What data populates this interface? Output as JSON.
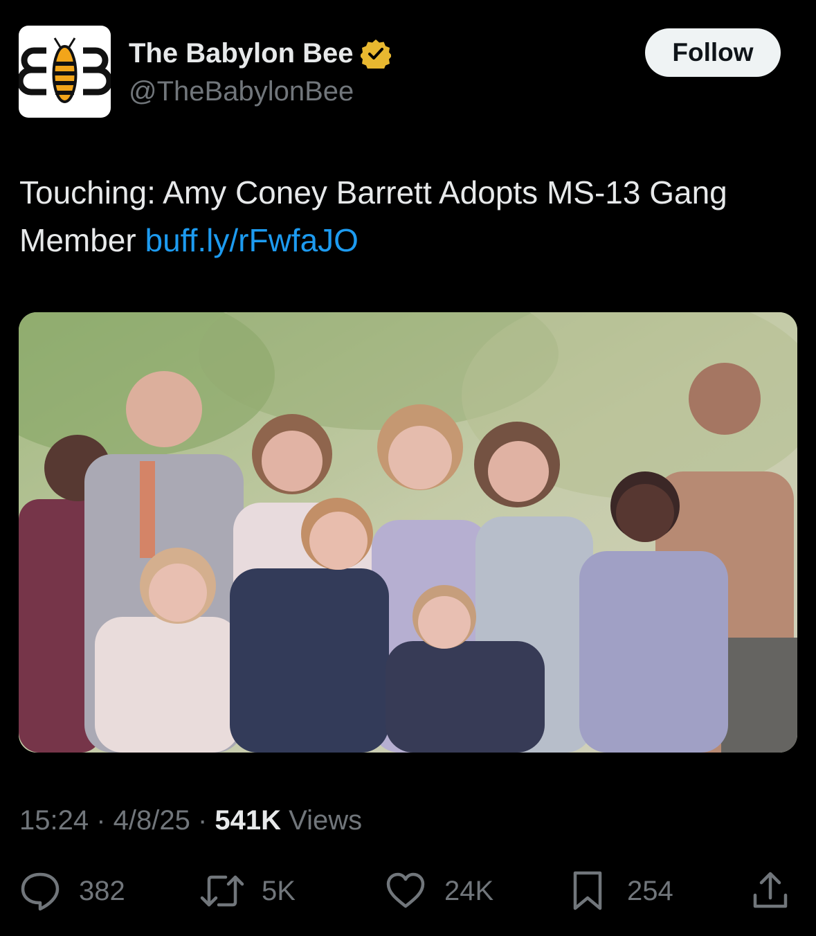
{
  "author": {
    "display_name": "The Babylon Bee",
    "handle": "@TheBabylonBee",
    "verified_badge_color": "#e8b830",
    "avatar_icon": "babylon-bee-logo"
  },
  "follow_label": "Follow",
  "tweet": {
    "text": "Touching: Amy Coney Barrett Adopts MS-13 Gang Member ",
    "link": "buff.ly/rFwfaJO"
  },
  "media": {
    "kind": "photo"
  },
  "meta": {
    "time": "15:24",
    "sep1": " · ",
    "date": "4/8/25",
    "sep2": " · ",
    "views_count": "541K",
    "views_label": " Views"
  },
  "actions": {
    "replies": "382",
    "reposts": "5K",
    "likes": "24K",
    "bookmarks": "254"
  },
  "colors": {
    "background": "#000000",
    "text": "#e7e9ea",
    "muted": "#71767b",
    "link": "#1d9bf0",
    "follow_bg": "#eff3f4"
  }
}
